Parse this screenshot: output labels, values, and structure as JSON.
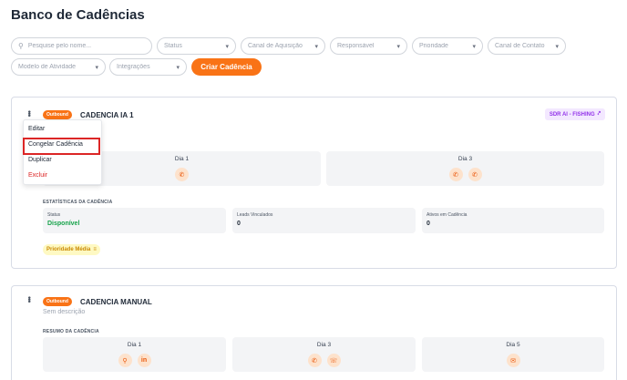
{
  "page": {
    "title": "Banco de Cadências"
  },
  "filters": {
    "search_placeholder": "Pesquise pelo nome...",
    "status": "Status",
    "canal_aquisicao": "Canal de Aquisição",
    "responsavel": "Responsável",
    "prioridade": "Prioridade",
    "canal_contato": "Canal de Contato",
    "modelo_atividade": "Modelo de Atividade",
    "integracoes": "Integrações",
    "create_button": "Criar Cadência"
  },
  "colors": {
    "accent": "#f97316",
    "danger": "#dc2626",
    "success": "#16a34a",
    "purple": "#9333ea"
  },
  "cadences": [
    {
      "badge": "Outbound",
      "title": "CADENCIA IA 1",
      "tag": "SDR AI - FISHING",
      "days": [
        {
          "label": "Dia 1",
          "icons": [
            "phone-icon"
          ]
        },
        {
          "label": "Dia 3",
          "icons": [
            "phone-icon",
            "phone-icon"
          ]
        }
      ],
      "stats_label": "ESTATÍSTICAS DA CADÊNCIA",
      "stats": [
        {
          "label": "Status",
          "value": "Disponível"
        },
        {
          "label": "Leads Vinculados",
          "value": "0"
        },
        {
          "label": "Ativos em Cadência",
          "value": "0"
        }
      ],
      "priority": "Prioridade Média"
    },
    {
      "badge": "Outbound",
      "title": "CADENCIA MANUAL",
      "description": "Sem descrição",
      "summary_label": "RESUMO DA CADÊNCIA",
      "days": [
        {
          "label": "Dia 1",
          "icons": [
            "search-icon",
            "linkedin-icon"
          ]
        },
        {
          "label": "Dia 3",
          "icons": [
            "phone-icon",
            "whatsapp-icon"
          ]
        },
        {
          "label": "Dia 5",
          "icons": [
            "email-icon"
          ]
        }
      ]
    }
  ],
  "context_menu": {
    "items": [
      "Editar",
      "Congelar Cadência",
      "Duplicar",
      "Excluir"
    ]
  }
}
